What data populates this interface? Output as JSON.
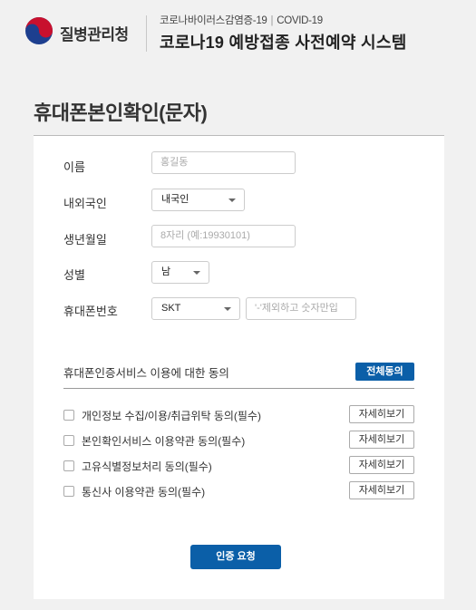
{
  "header": {
    "logo_text": "질병관리청",
    "sub_title_left": "코로나바이러스감염증-19",
    "sub_title_right": "COVID-19",
    "sub_title_separator": "|",
    "main_title": "코로나19 예방접종 사전예약 시스템"
  },
  "page": {
    "title": "휴대폰본인확인(문자)"
  },
  "form": {
    "name_label": "이름",
    "name_placeholder": "홍길동",
    "nationality_label": "내외국인",
    "nationality_value": "내국인",
    "birth_label": "생년월일",
    "birth_placeholder": "8자리 (예:19930101)",
    "gender_label": "성별",
    "gender_value": "남",
    "phone_label": "휴대폰번호",
    "carrier_value": "SKT",
    "phone_placeholder": "'-'제외하고 숫자만입"
  },
  "agreement": {
    "title": "휴대폰인증서비스 이용에 대한 동의",
    "all_agree_label": "전체동의",
    "items": [
      {
        "label": "개인정보 수집/이용/취급위탁 동의(필수)",
        "detail_label": "자세히보기"
      },
      {
        "label": "본인확인서비스 이용약관 동의(필수)",
        "detail_label": "자세히보기"
      },
      {
        "label": "고유식별정보처리 동의(필수)",
        "detail_label": "자세히보기"
      },
      {
        "label": "통신사 이용약관 동의(필수)",
        "detail_label": "자세히보기"
      }
    ]
  },
  "submit_label": "인증 요청",
  "colors": {
    "accent": "#0b5fa8",
    "logo_red": "#c8102e",
    "logo_blue": "#1d3f8f"
  }
}
